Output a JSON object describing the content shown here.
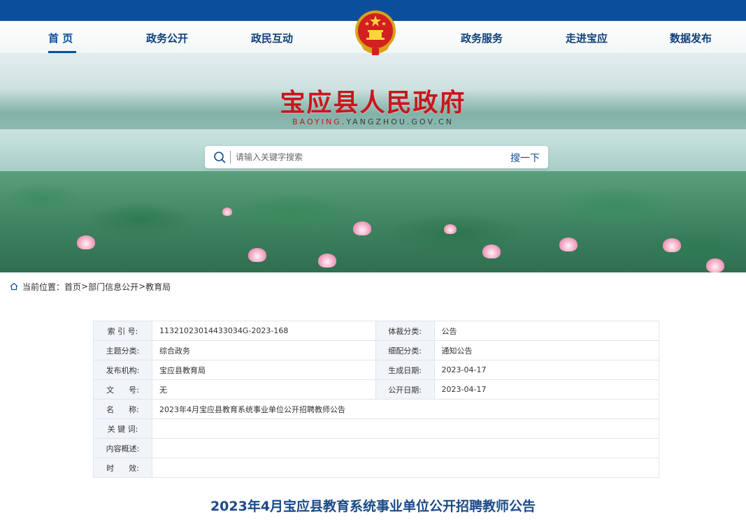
{
  "nav": {
    "left": [
      {
        "label": "首  页",
        "active": true
      },
      {
        "label": "政务公开"
      },
      {
        "label": "政民互动"
      }
    ],
    "right": [
      {
        "label": "政务服务"
      },
      {
        "label": "走进宝应"
      },
      {
        "label": "数据发布"
      }
    ]
  },
  "header": {
    "title": "宝应县人民政府",
    "url_prefix": "BAOYING",
    "url_rest": ".YANGZHOU.GOV.CN",
    "emblem_icon": "national-emblem-icon"
  },
  "search": {
    "placeholder": "请输入关键字搜索",
    "button_label": "搜一下"
  },
  "breadcrumb": {
    "label": "当前位置：",
    "items": [
      "首页",
      "部门信息公开",
      "教育局"
    ],
    "separator": ">"
  },
  "info": {
    "index_no_key": "索 引 号:",
    "index_no_val": "11321023014433034G-2023-168",
    "genre_key": "体裁分类:",
    "genre_val": "公告",
    "topic_key": "主题分类:",
    "topic_val": "综合政务",
    "detail_key": "细配分类:",
    "detail_val": "通知公告",
    "org_key": "发布机构:",
    "org_val": "宝应县教育局",
    "created_key": "生成日期:",
    "created_val": "2023-04-17",
    "docno_key": "文      号:",
    "docno_val": "无",
    "public_key": "公开日期:",
    "public_val": "2023-04-17",
    "name_key": "名      称:",
    "name_val": "2023年4月宝应县教育系统事业单位公开招聘教师公告",
    "keyword_key": "关 键 词:",
    "keyword_val": "",
    "summary_key": "内容概述:",
    "summary_val": "",
    "validity_key": "时      效:",
    "validity_val": ""
  },
  "article": {
    "title": "2023年4月宝应县教育系统事业单位公开招聘教师公告"
  },
  "colors": {
    "brand_blue": "#0b4f9c",
    "title_red": "#c8161d"
  }
}
